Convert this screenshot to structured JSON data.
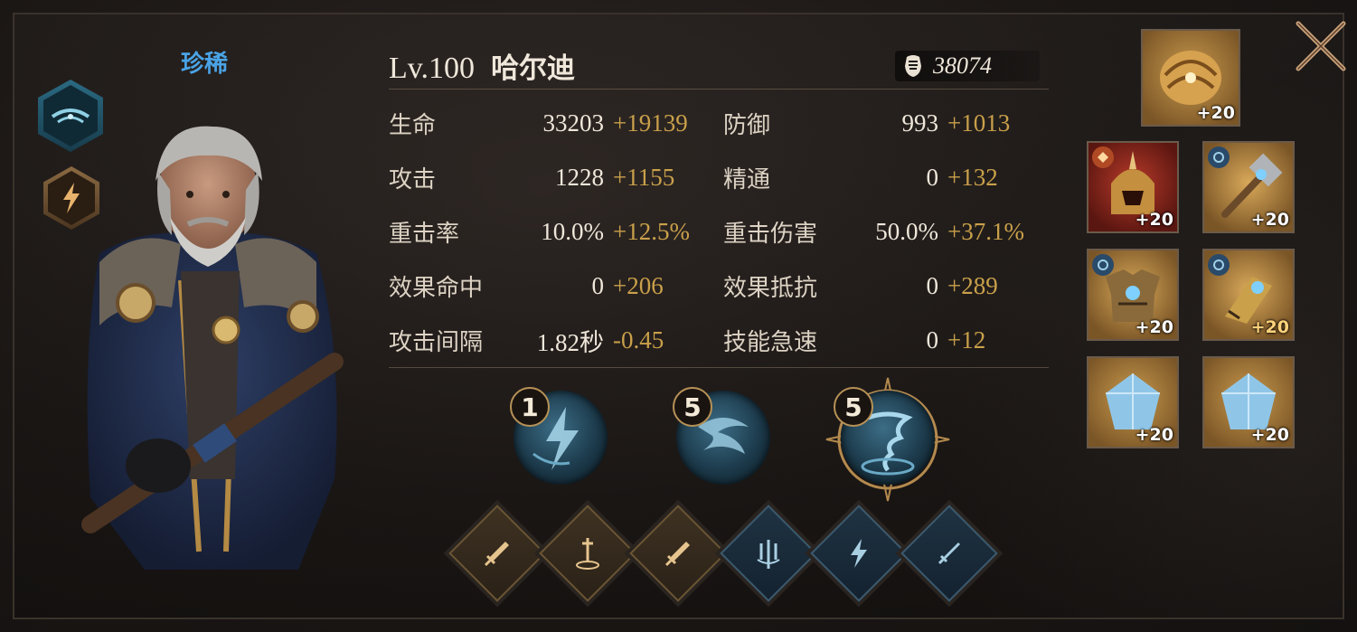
{
  "hero": {
    "rarity": "珍稀",
    "level": "Lv.100",
    "name": "哈尔迪",
    "power": "38074"
  },
  "stats": [
    {
      "left": {
        "label": "生命",
        "base": "33203",
        "bonus": "+19139"
      },
      "right": {
        "label": "防御",
        "base": "993",
        "bonus": "+1013"
      }
    },
    {
      "left": {
        "label": "攻击",
        "base": "1228",
        "bonus": "+1155"
      },
      "right": {
        "label": "精通",
        "base": "0",
        "bonus": "+132"
      }
    },
    {
      "left": {
        "label": "重击率",
        "base": "10.0%",
        "bonus": "+12.5%"
      },
      "right": {
        "label": "重击伤害",
        "base": "50.0%",
        "bonus": "+37.1%"
      }
    },
    {
      "left": {
        "label": "效果命中",
        "base": "0",
        "bonus": "+206"
      },
      "right": {
        "label": "效果抵抗",
        "base": "0",
        "bonus": "+289"
      }
    },
    {
      "left": {
        "label": "攻击间隔",
        "base": "1.82秒",
        "bonus": "-0.45"
      },
      "right": {
        "label": "技能急速",
        "base": "0",
        "bonus": "+12"
      }
    }
  ],
  "skills": [
    {
      "level": "1",
      "icon": "lightning-bolt-icon"
    },
    {
      "level": "5",
      "icon": "lightning-swirl-icon"
    },
    {
      "level": "5",
      "icon": "lightning-tornado-icon"
    }
  ],
  "talents": [
    {
      "icon": "sword-icon",
      "style": "gold"
    },
    {
      "icon": "sword-in-ground-icon",
      "style": "gold"
    },
    {
      "icon": "sword-icon",
      "style": "gold"
    },
    {
      "icon": "trident-icon",
      "style": "blue"
    },
    {
      "icon": "lightning-icon",
      "style": "blue"
    },
    {
      "icon": "dagger-icon",
      "style": "blue"
    }
  ],
  "equipment": {
    "top": {
      "icon": "gold-gauntlet-relic-icon",
      "level": "+20"
    },
    "items": [
      {
        "icon": "spiked-helmet-icon",
        "level": "+20"
      },
      {
        "icon": "war-hammer-icon",
        "level": "+20"
      },
      {
        "icon": "plate-armor-icon",
        "level": "+20"
      },
      {
        "icon": "armored-gauntlet-icon",
        "level": "+20"
      },
      {
        "icon": "ice-crystal-icon",
        "level": "+20"
      },
      {
        "icon": "ice-crystal-icon",
        "level": "+20"
      }
    ]
  },
  "colors": {
    "rarity": "#4aa3e6",
    "bonus": "#c9a04a",
    "background": "#1b1715"
  }
}
